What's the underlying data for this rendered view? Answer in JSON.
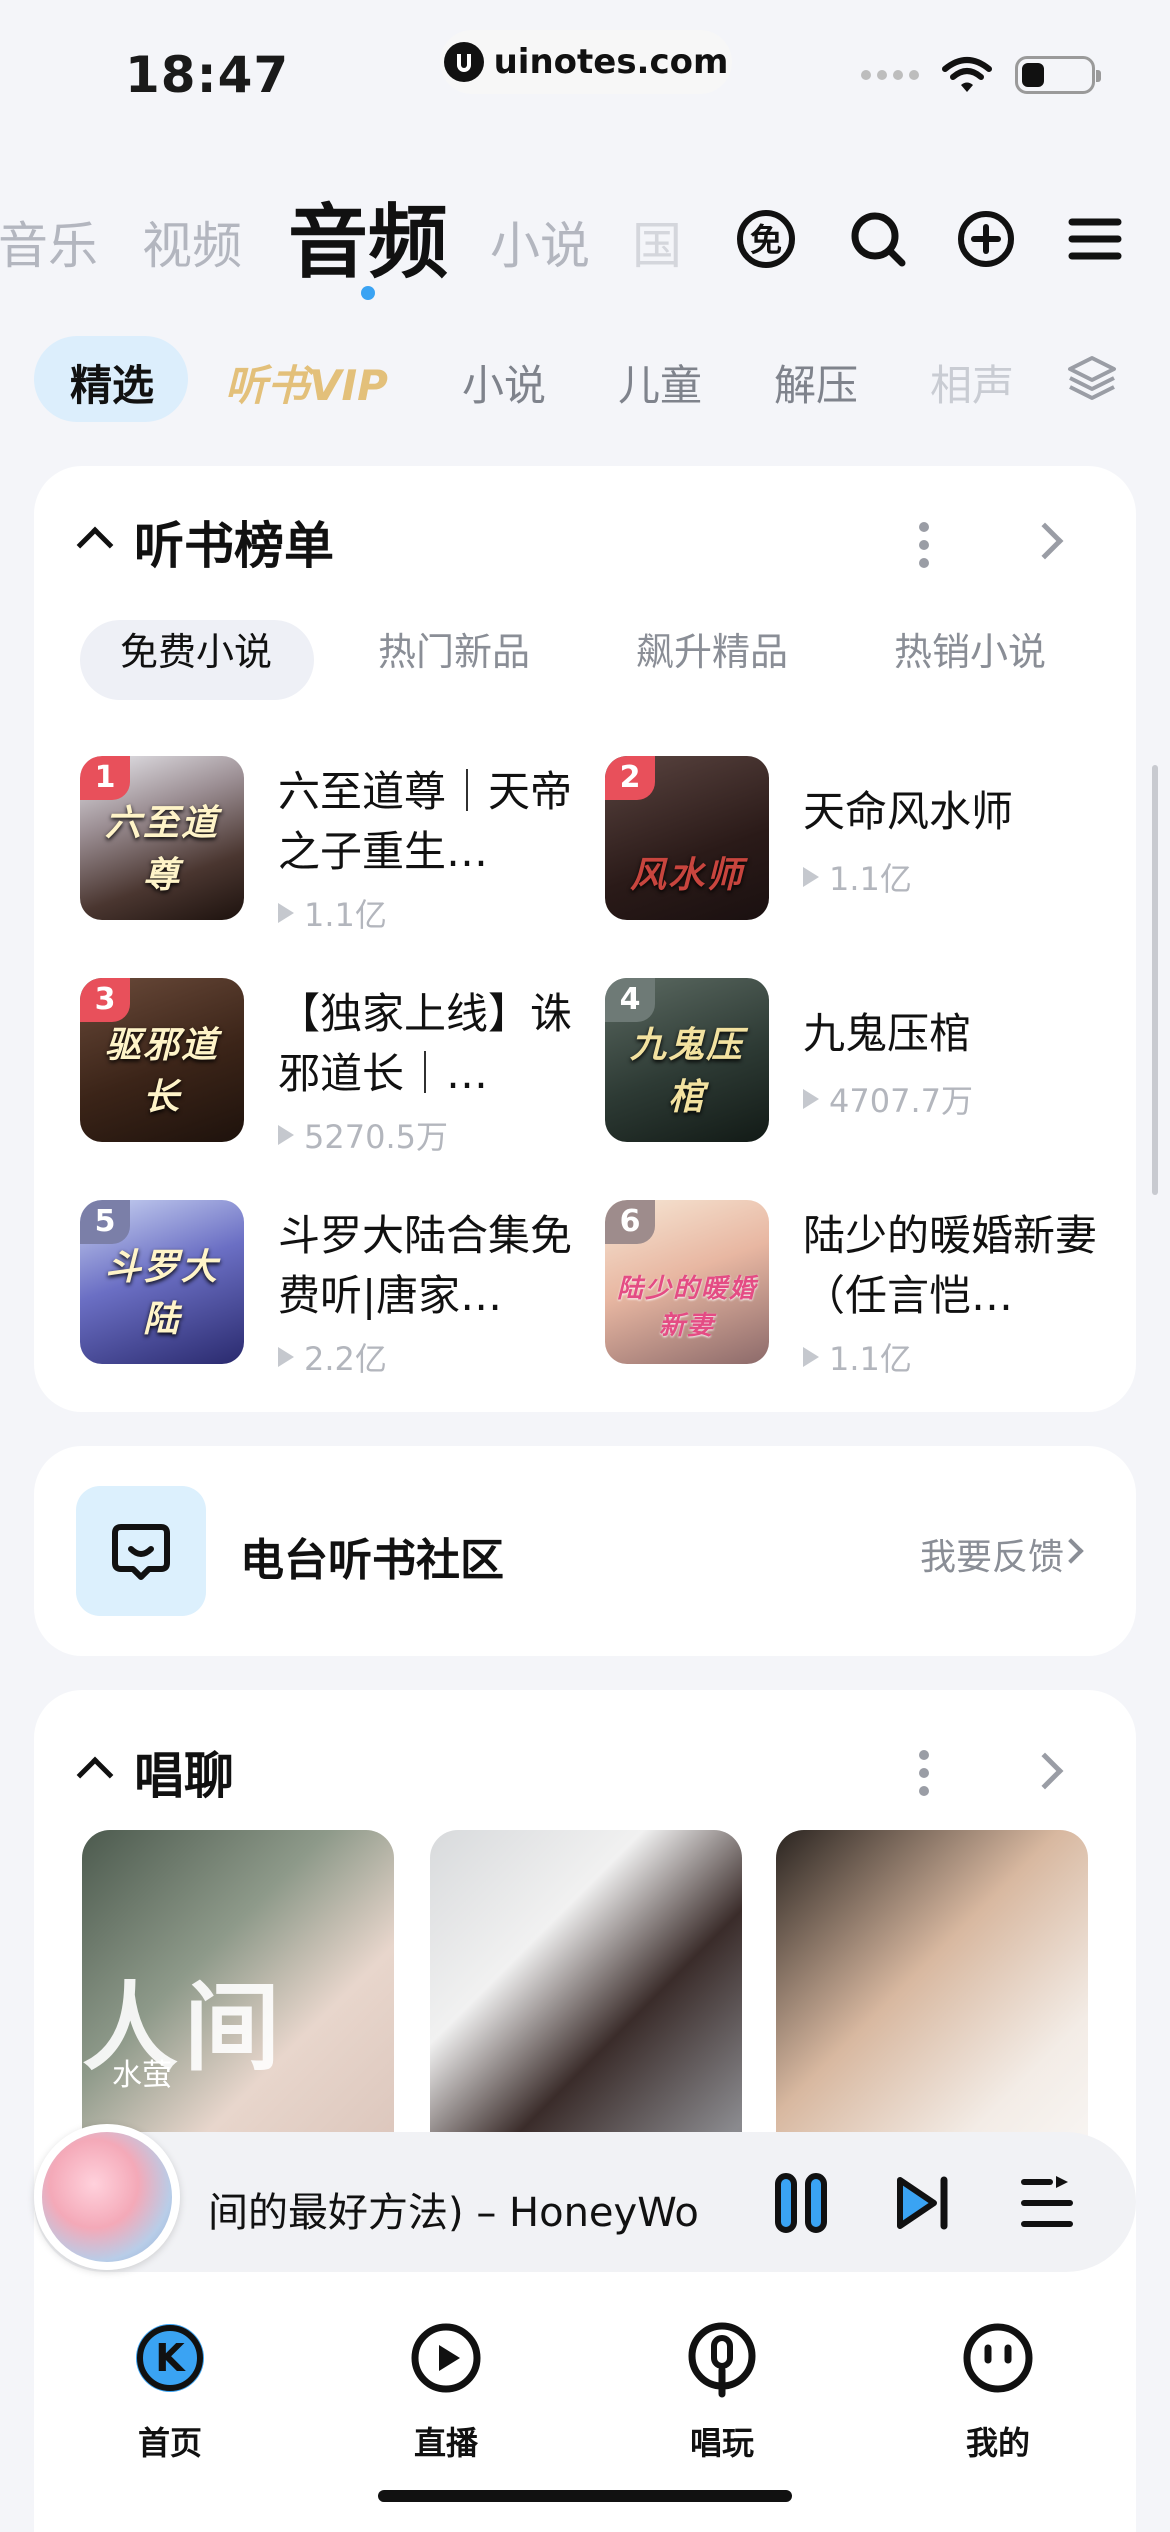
{
  "status_bar": {
    "time": "18:47",
    "url": "uinotes.com"
  },
  "top_nav": {
    "items": [
      "音乐",
      "视频",
      "音频",
      "小说",
      "国"
    ],
    "active": "音频"
  },
  "sub_tabs": [
    "精选",
    "听书VIP",
    "小说",
    "儿童",
    "解压",
    "相声"
  ],
  "ranking": {
    "title": "听书榜单",
    "tabs": [
      "免费小说",
      "热门新品",
      "飙升精品",
      "热销小说"
    ],
    "items": [
      {
        "rank": "1",
        "title": "六至道尊｜天帝之子重生…",
        "plays": "1.1亿",
        "cover_text": "六至道尊"
      },
      {
        "rank": "2",
        "title": "天命风水师",
        "plays": "1.1亿",
        "cover_text": "风水师"
      },
      {
        "rank": "3",
        "title": "【独家上线】诛邪道长｜…",
        "plays": "5270.5万",
        "cover_text": "驱邪道长"
      },
      {
        "rank": "4",
        "title": "九鬼压棺",
        "plays": "4707.7万",
        "cover_text": "九鬼压棺"
      },
      {
        "rank": "5",
        "title": "斗罗大陆合集免费听|唐家…",
        "plays": "2.2亿",
        "cover_text": "斗罗大陆"
      },
      {
        "rank": "6",
        "title": "陆少的暖婚新妻（任言恺…",
        "plays": "1.1亿",
        "cover_text": "陆少的暖婚新妻"
      }
    ],
    "rank_colors": {
      "top": "#e8505b",
      "other": "#8b8e96"
    }
  },
  "community": {
    "title": "电台听书社区",
    "feedback": "我要反馈"
  },
  "chat": {
    "title": "唱聊",
    "photo1_text": "人间",
    "photo1_subtext": "水萤"
  },
  "player": {
    "song": "间的最好方法) – HoneyWo"
  },
  "bottom_tabs": [
    {
      "label": "首页",
      "icon": "k-logo-icon"
    },
    {
      "label": "直播",
      "icon": "play-circle-icon"
    },
    {
      "label": "唱玩",
      "icon": "microphone-icon"
    },
    {
      "label": "我的",
      "icon": "face-icon"
    }
  ],
  "colors": {
    "accent": "#3aa3f3",
    "vip": "#e3c07a",
    "pill": "#dceefc"
  }
}
